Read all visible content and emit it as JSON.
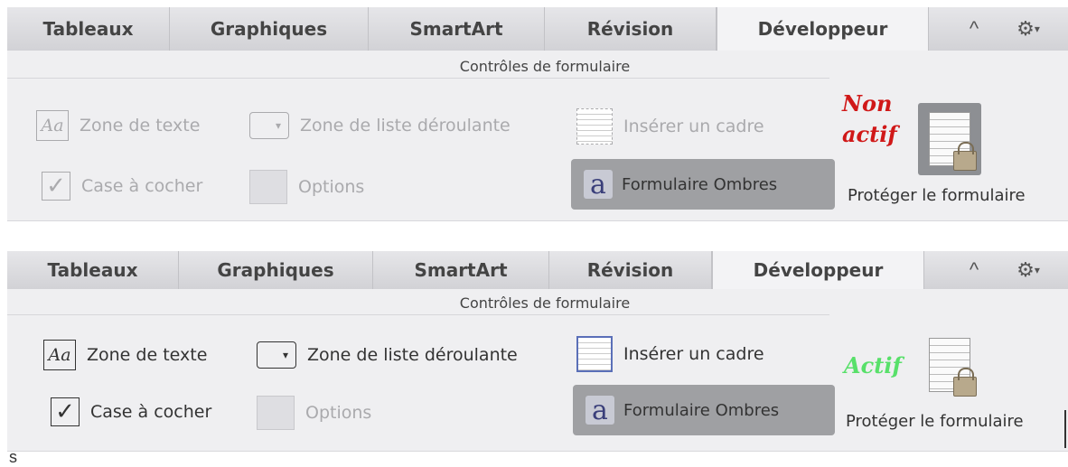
{
  "top_panel": {
    "tabs": [
      "Tableaux",
      "Graphiques",
      "SmartArt",
      "Révision",
      "Développeur"
    ],
    "active_tab": "Développeur",
    "group_title": "Contrôles de formulaire",
    "controls": {
      "text_zone": "Zone de texte",
      "dropdown_list": "Zone de liste déroulante",
      "insert_frame": "Insérer un cadre",
      "checkbox": "Case à cocher",
      "options": "Options",
      "shade_form": "Formulaire Ombres"
    },
    "status_line1": "Non",
    "status_line2": "actif",
    "protect_label": "Protéger le formulaire"
  },
  "bottom_panel": {
    "tabs": [
      "Tableaux",
      "Graphiques",
      "SmartArt",
      "Révision",
      "Développeur"
    ],
    "active_tab": "Développeur",
    "group_title": "Contrôles de formulaire",
    "controls": {
      "text_zone": "Zone de texte",
      "dropdown_list": "Zone de liste déroulante",
      "insert_frame": "Insérer un cadre",
      "checkbox": "Case à cocher",
      "options": "Options",
      "shade_form": "Formulaire Ombres"
    },
    "status": "Actif",
    "protect_label": "Protéger le formulaire",
    "left_edge_text": "s"
  },
  "icons": {
    "collapse": "^",
    "gear": "⚙",
    "gear_caret": "▾",
    "dropdown_arrow": "▾",
    "check": "✓",
    "text_field_glyph": "Aa",
    "form_glyph": "a"
  },
  "colors": {
    "status_inactive": "#d01818",
    "status_active": "#58e06a"
  }
}
